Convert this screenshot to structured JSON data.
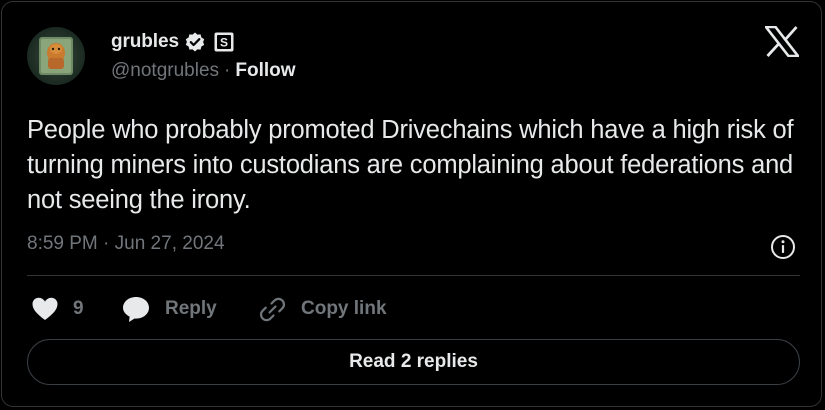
{
  "author": {
    "display_name": "grubles",
    "handle": "@notgrubles",
    "separator": "·",
    "follow_label": "Follow",
    "verified_color": "#e7e9ea",
    "affiliate_badge_text": "S"
  },
  "tweet": {
    "text": "People who probably promoted Drivechains which have a high risk of turning miners into custodians are complaining about federations and not seeing the irony.",
    "timestamp": "8:59 PM · Jun 27, 2024"
  },
  "actions": {
    "like_count": "9",
    "reply_label": "Reply",
    "copy_link_label": "Copy link"
  },
  "replies_button": {
    "label": "Read 2 replies"
  },
  "icons": {
    "brand": "x-logo-icon",
    "verified": "verified-badge-icon",
    "affiliate": "affiliate-badge-icon",
    "info": "info-icon",
    "like": "heart-icon",
    "reply": "speech-bubble-icon",
    "copy": "link-icon"
  },
  "colors": {
    "background": "#000000",
    "text_primary": "#e7e9ea",
    "text_secondary": "#71767b",
    "border": "#2f3336"
  }
}
